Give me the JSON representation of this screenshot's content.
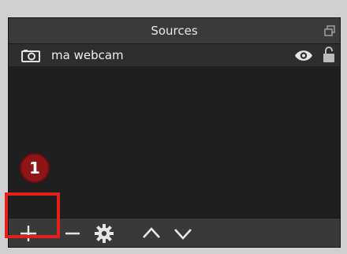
{
  "panel": {
    "title": "Sources"
  },
  "sources": [
    {
      "label": "ma webcam",
      "icon": "camera-icon",
      "visible": true,
      "locked": false
    }
  ],
  "toolbar": {
    "buttons": [
      {
        "name": "add-source-button",
        "icon": "plus-icon"
      },
      {
        "name": "remove-source-button",
        "icon": "minus-icon"
      },
      {
        "name": "source-properties-button",
        "icon": "gear-icon"
      },
      {
        "name": "move-source-up-button",
        "icon": "chevron-up-icon"
      },
      {
        "name": "move-source-down-button",
        "icon": "chevron-down-icon"
      }
    ]
  },
  "annotation": {
    "step_number": "1",
    "highlight_color": "#e3201b",
    "badge_color": "#8f1416"
  },
  "colors": {
    "panel_bg": "#2a2a2a",
    "header_bg": "#3a3a3a",
    "row_bg": "#2e2e2e",
    "text": "#efefef"
  }
}
